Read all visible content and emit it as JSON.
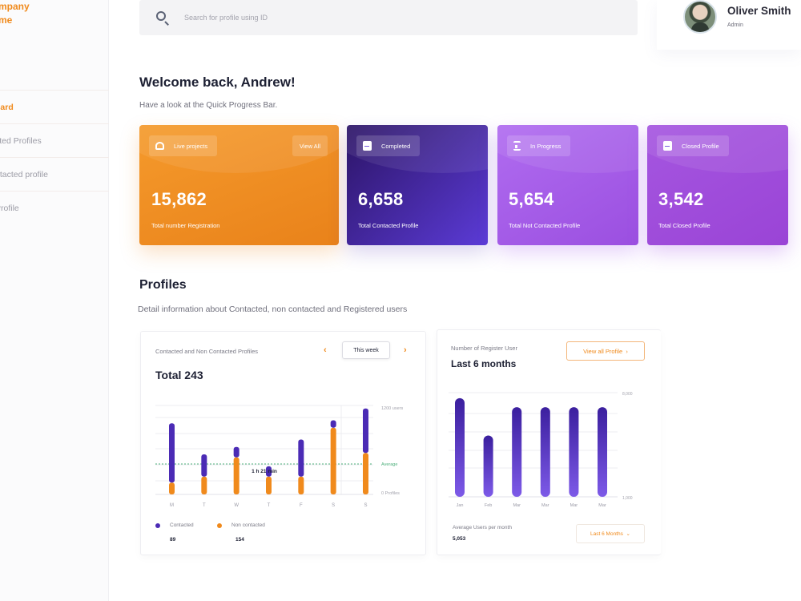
{
  "sidebar": {
    "brand_line1": "mpany",
    "brand_line2": "me",
    "items": [
      {
        "label": "oard",
        "active": true
      },
      {
        "label": "cted Profiles",
        "active": false
      },
      {
        "label": "ntacted profile",
        "active": false
      },
      {
        "label": "Profile",
        "active": false
      }
    ]
  },
  "search": {
    "placeholder": "Search for profile using ID",
    "icon": "search-icon"
  },
  "user": {
    "name": "Oliver Smith",
    "role": "Admin"
  },
  "welcome": {
    "title": "Welcome back, Andrew!",
    "subtitle": "Have a look at the Quick Progress Bar."
  },
  "cards": [
    {
      "chip": "Live projects",
      "action": "View All",
      "value": "15,862",
      "label": "Total number Registration",
      "icon": "live-icon"
    },
    {
      "chip": "Completed",
      "value": "6,658",
      "label": "Total Contacted Profile",
      "icon": "document-icon"
    },
    {
      "chip": "In Progress",
      "value": "5,654",
      "label": "Total Not Contacted Profile",
      "icon": "hourglass-icon"
    },
    {
      "chip": "Closed Profile",
      "value": "3,542",
      "label": "Total Closed Profile",
      "icon": "document-icon"
    }
  ],
  "profiles": {
    "title": "Profiles",
    "subtitle": "Detail information about Contacted, non contacted and Registered users"
  },
  "weekly_panel": {
    "title": "Contacted and Non Contacted Profiles",
    "total": "Total 243",
    "range_button": "This week",
    "prev": "‹",
    "next": "›",
    "tooltip": "1 h 21 min",
    "legend": [
      {
        "label": "Contacted",
        "value": "89",
        "color": "#4b2bb5"
      },
      {
        "label": "Non contacted",
        "value": "154",
        "color": "#f08a1c"
      }
    ]
  },
  "monthly_panel": {
    "title": "Number of Register User",
    "subtitle": "Last 6 months",
    "view_button": "View all Profile",
    "avg_label": "Average Users per month",
    "avg_value": "5,053",
    "months_button": "Last 6 Months"
  },
  "chart_data": [
    {
      "type": "bar",
      "stacked": true,
      "categories": [
        "M",
        "T",
        "W",
        "T",
        "F",
        "S",
        "S"
      ],
      "series": [
        {
          "name": "Contacted",
          "color": "#4b2bb5",
          "values": [
            40,
            15,
            7,
            7,
            25,
            5,
            30
          ]
        },
        {
          "name": "Non contacted",
          "color": "#f08a1c",
          "values": [
            8,
            12,
            25,
            12,
            12,
            45,
            28
          ]
        }
      ],
      "y_right_labels": [
        "1200 users",
        "Average",
        "0 Profiles"
      ],
      "grid": true
    },
    {
      "type": "bar",
      "categories": [
        "Jan",
        "Feb",
        "Mar",
        "Mar",
        "Mar",
        "Mar"
      ],
      "series": [
        {
          "name": "",
          "color": "#4b2bb5",
          "values": [
            6600,
            4100,
            6000,
            6000,
            6000,
            6000
          ]
        }
      ],
      "ylim": [
        0,
        7000
      ],
      "y_right_labels": [
        "8,000",
        "1,000"
      ],
      "grid": true
    }
  ]
}
